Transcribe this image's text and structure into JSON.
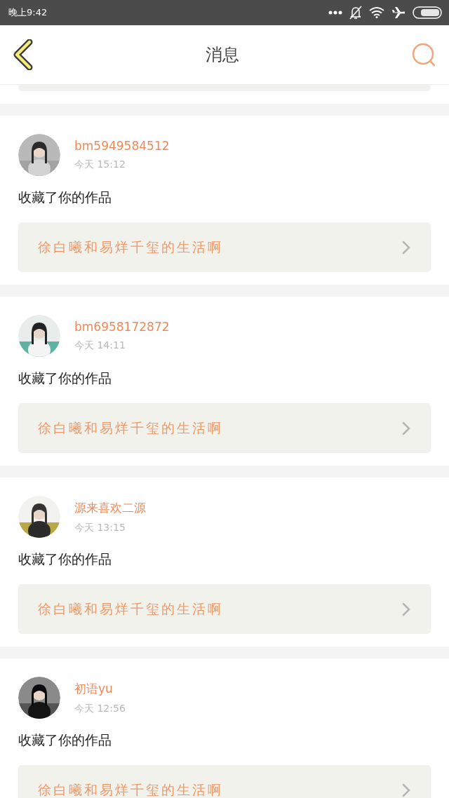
{
  "status_bar": {
    "time": "晚上9:42"
  },
  "header": {
    "title": "消息"
  },
  "notifications": [
    {
      "user": "bm5949584512",
      "time": "今天 15:12",
      "action": "收藏了你的作品",
      "work": "徐白曦和易烊千玺的生活啊"
    },
    {
      "user": "bm6958172872",
      "time": "今天 14:11",
      "action": "收藏了你的作品",
      "work": "徐白曦和易烊千玺的生活啊"
    },
    {
      "user": "源来喜欢二源",
      "time": "今天 13:15",
      "action": "收藏了你的作品",
      "work": "徐白曦和易烊千玺的生活啊"
    },
    {
      "user": "初语yu",
      "time": "今天 12:56",
      "action": "收藏了你的作品",
      "work": "徐白曦和易烊千玺的生活啊"
    }
  ]
}
